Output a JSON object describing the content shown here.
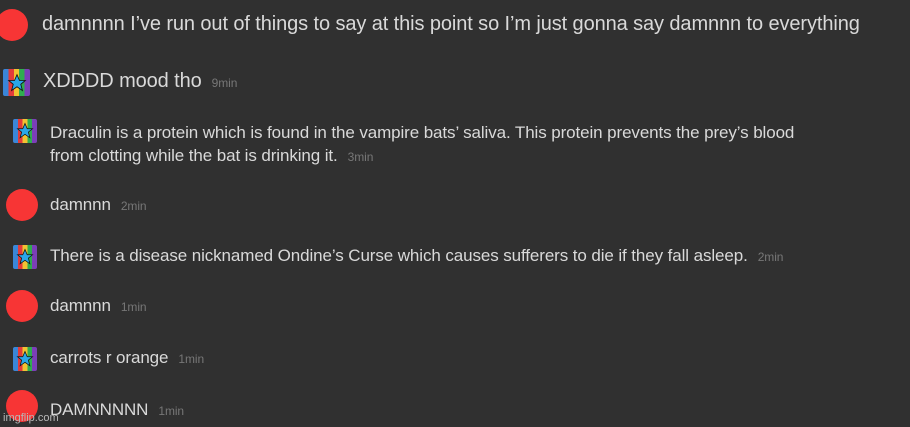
{
  "messages": [
    {
      "avatar": "red-circle-avatar",
      "text": "damnnnn I’ve run out of things to say at this point so I’m just gonna say damnnn to everything",
      "time": ""
    },
    {
      "avatar": "rainbow-star-avatar",
      "text": "XDDDD mood tho",
      "time": "9min"
    },
    {
      "avatar": "rainbow-star-avatar",
      "text_line1": "Draculin is a protein which is found in the vampire bats’ saliva. This protein prevents the prey’s blood",
      "text_line2": "from clotting while the bat is drinking it.",
      "time": "3min"
    },
    {
      "avatar": "red-circle-avatar",
      "text": "damnnn",
      "time": "2min"
    },
    {
      "avatar": "rainbow-star-avatar",
      "text": "There is a disease nicknamed Ondine’s Curse which causes sufferers to die if they fall asleep.",
      "time": "2min"
    },
    {
      "avatar": "red-circle-avatar",
      "text": "damnnn",
      "time": "1min"
    },
    {
      "avatar": "rainbow-star-avatar",
      "text": "carrots r orange",
      "time": "1min"
    },
    {
      "avatar": "red-circle-avatar",
      "text": "DAMNNNNN",
      "time": "1min"
    }
  ],
  "watermark": "imgflip.com",
  "colors": {
    "background": "#303030",
    "text": "#d9d9d9",
    "timestamp": "#777777",
    "red_avatar": "#f73535"
  }
}
